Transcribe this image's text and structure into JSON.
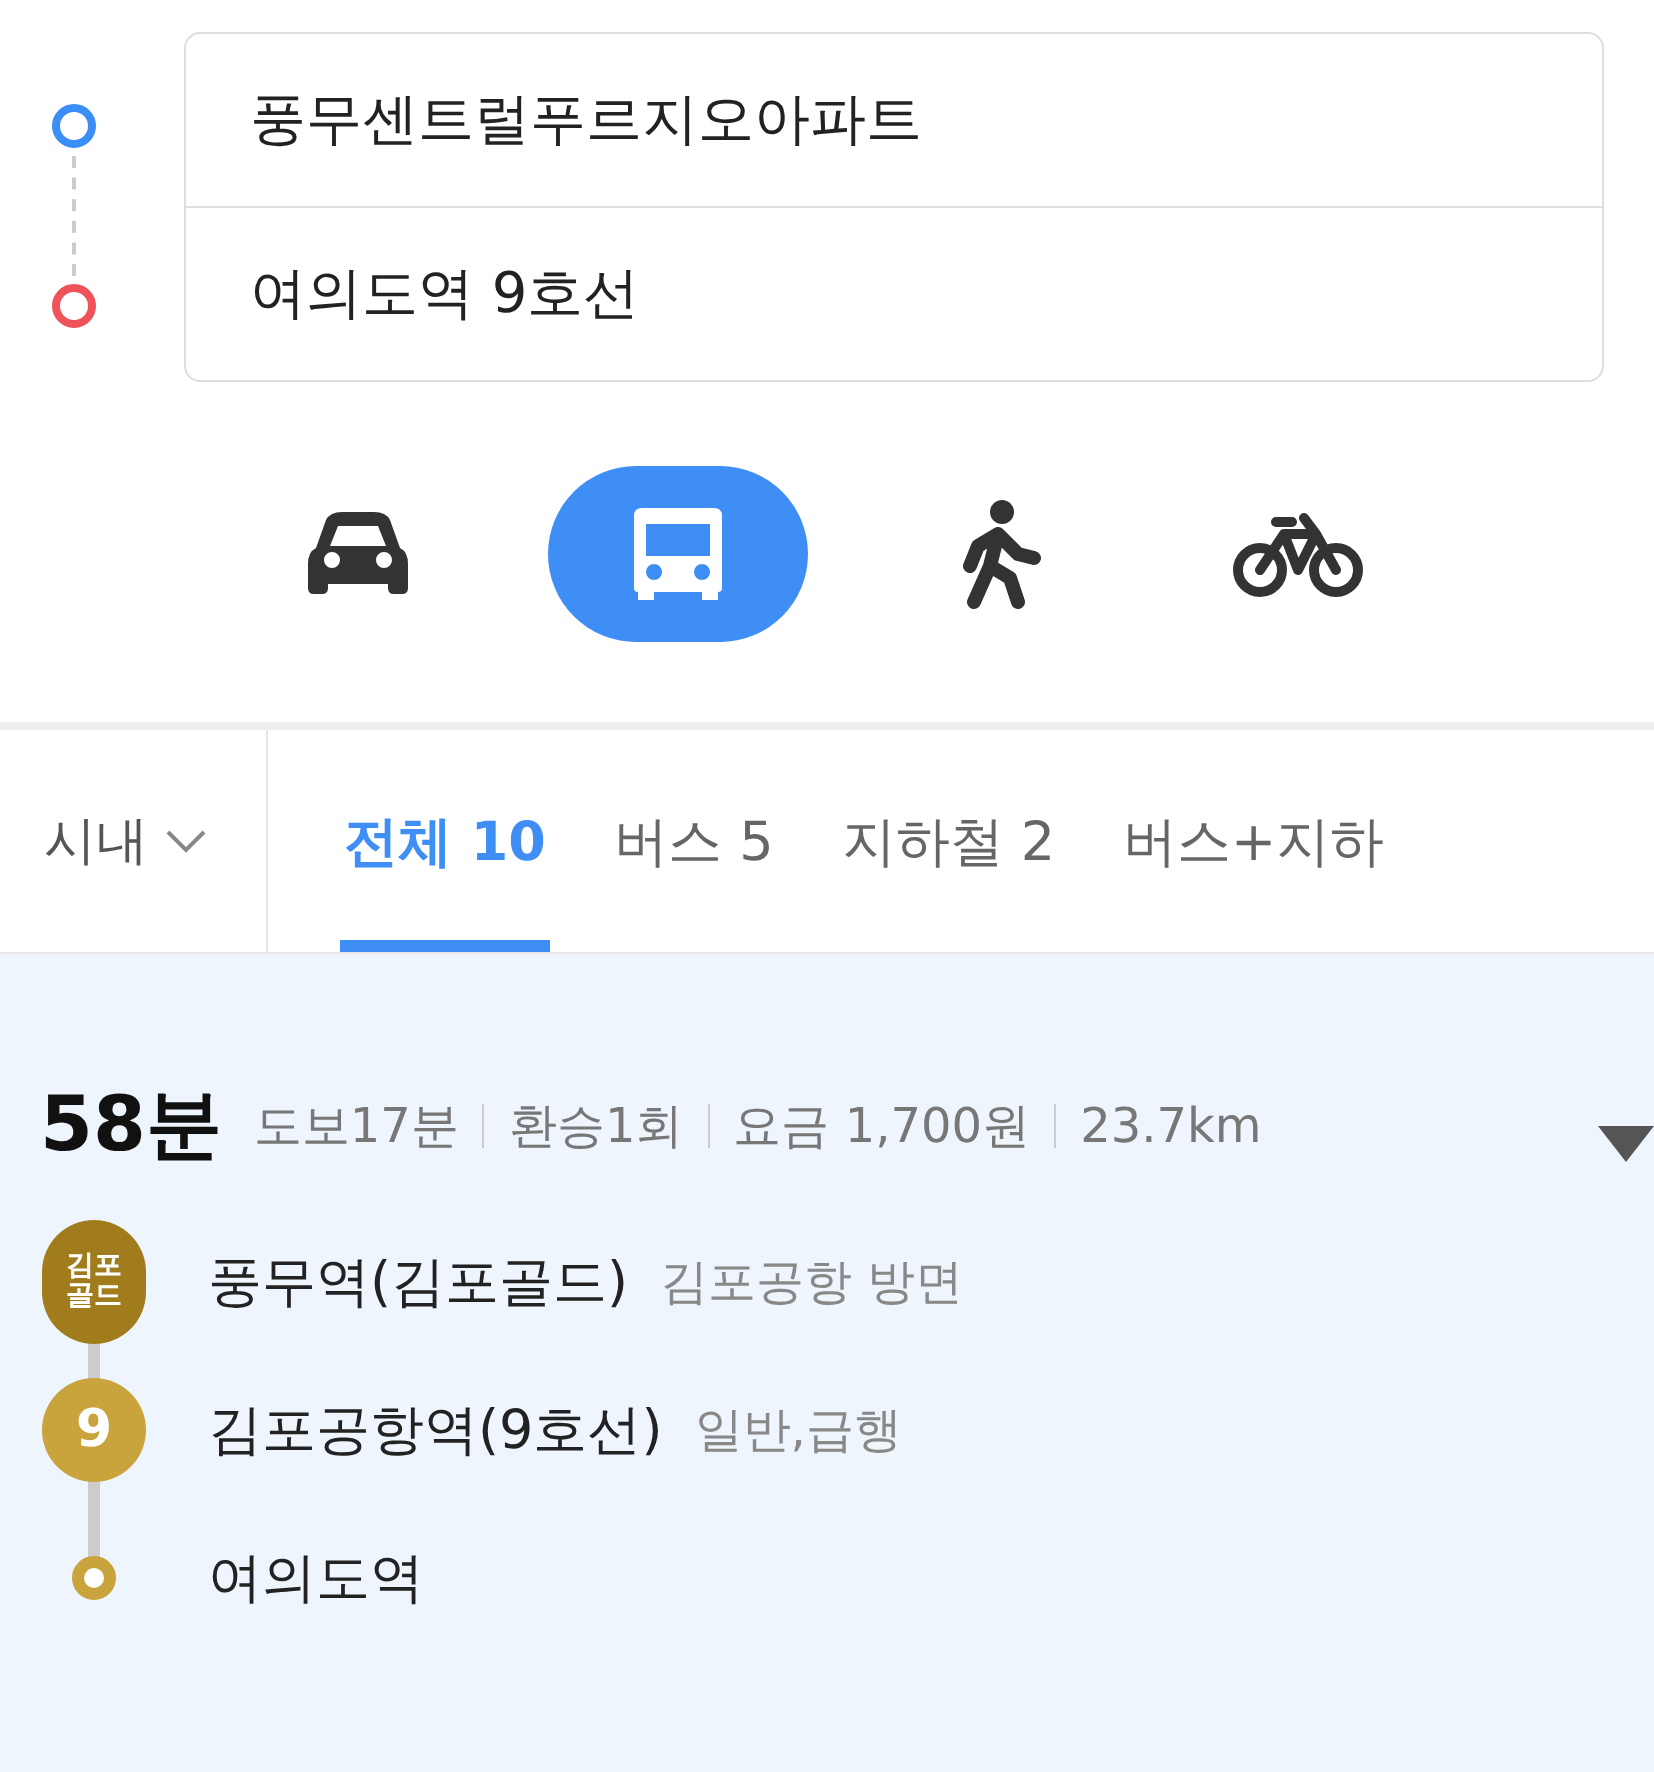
{
  "route": {
    "origin": "풍무센트럴푸르지오아파트",
    "destination": "여의도역 9호선"
  },
  "modes": [
    {
      "kind": "car",
      "selected": false
    },
    {
      "kind": "bus",
      "selected": true
    },
    {
      "kind": "walk",
      "selected": false
    },
    {
      "kind": "bike",
      "selected": false
    }
  ],
  "region": {
    "label": "시내"
  },
  "tabs": [
    {
      "label": "전체 10",
      "selected": true
    },
    {
      "label": "버스 5",
      "selected": false
    },
    {
      "label": "지하철 2",
      "selected": false
    },
    {
      "label": "버스+지하",
      "selected": false
    }
  ],
  "result": {
    "time": "58분",
    "details": [
      "도보17분",
      "환승1회",
      "요금 1,700원",
      "23.7km"
    ],
    "stops": [
      {
        "kind": "badge",
        "badge": "김포골드",
        "color": "#a07c1c",
        "name": "풍무역(김포골드)",
        "note": "김포공항 방면"
      },
      {
        "kind": "badge",
        "badge": "9",
        "color": "#c9a43c",
        "name": "김포공항역(9호선)",
        "note": "일반,급행"
      },
      {
        "kind": "end",
        "color": "#c9a43c",
        "name": "여의도역"
      }
    ]
  }
}
